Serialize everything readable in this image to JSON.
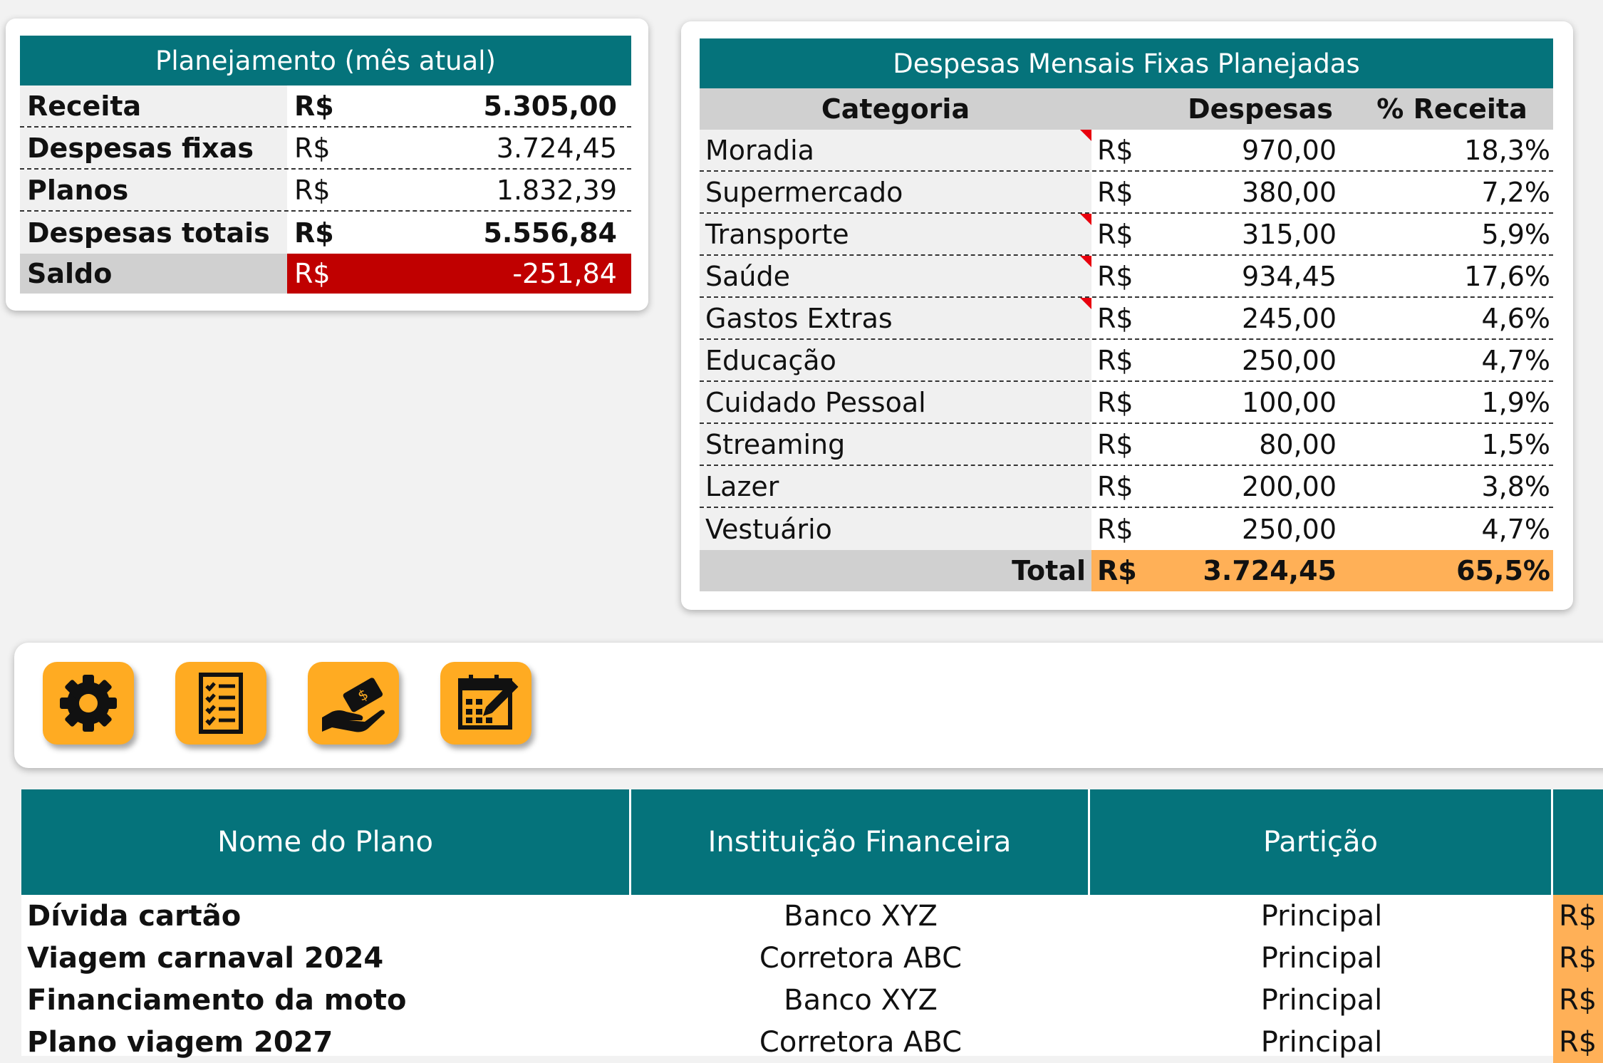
{
  "planning": {
    "title": "Planejamento (mês atual)",
    "rows": [
      {
        "label": "Receita",
        "currency": "R$",
        "value": "5.305,00"
      },
      {
        "label": "Despesas fixas",
        "currency": "R$",
        "value": "3.724,45"
      },
      {
        "label": "Planos",
        "currency": "R$",
        "value": "1.832,39"
      },
      {
        "label": "Despesas totais",
        "currency": "R$",
        "value": "5.556,84"
      },
      {
        "label": "Saldo",
        "currency": "R$",
        "value": "-251,84"
      }
    ]
  },
  "fixed": {
    "title": "Despesas Mensais Fixas Planejadas",
    "headers": {
      "category": "Categoria",
      "expenses": "Despesas",
      "pct": "% Receita"
    },
    "rows": [
      {
        "category": "Moradia",
        "currency": "R$",
        "value": "970,00",
        "pct": "18,3%"
      },
      {
        "category": "Supermercado",
        "currency": "R$",
        "value": "380,00",
        "pct": "7,2%"
      },
      {
        "category": "Transporte",
        "currency": "R$",
        "value": "315,00",
        "pct": "5,9%"
      },
      {
        "category": "Saúde",
        "currency": "R$",
        "value": "934,45",
        "pct": "17,6%"
      },
      {
        "category": "Gastos Extras",
        "currency": "R$",
        "value": "245,00",
        "pct": "4,6%"
      },
      {
        "category": "Educação",
        "currency": "R$",
        "value": "250,00",
        "pct": "4,7%"
      },
      {
        "category": "Cuidado Pessoal",
        "currency": "R$",
        "value": "100,00",
        "pct": "1,9%"
      },
      {
        "category": "Streaming",
        "currency": "R$",
        "value": "80,00",
        "pct": "1,5%"
      },
      {
        "category": "Lazer",
        "currency": "R$",
        "value": "200,00",
        "pct": "3,8%"
      },
      {
        "category": "Vestuário",
        "currency": "R$",
        "value": "250,00",
        "pct": "4,7%"
      }
    ],
    "total": {
      "label": "Total",
      "currency": "R$",
      "value": "3.724,45",
      "pct": "65,5%"
    }
  },
  "toolbar": {
    "icons": [
      "gear-icon",
      "checklist-icon",
      "payment-hand-icon",
      "calendar-edit-icon"
    ],
    "accent": "#ffab22"
  },
  "plans": {
    "headers": {
      "name": "Nome do Plano",
      "institution": "Instituição Financeira",
      "partition": "Partição"
    },
    "rows": [
      {
        "name": "Dívida cartão",
        "institution": "Banco XYZ",
        "partition": "Principal",
        "currency": "R$"
      },
      {
        "name": "Viagem carnaval 2024",
        "institution": "Corretora ABC",
        "partition": "Principal",
        "currency": "R$"
      },
      {
        "name": "Financiamento da moto",
        "institution": "Banco XYZ",
        "partition": "Principal",
        "currency": "R$"
      },
      {
        "name": "Plano viagem 2027",
        "institution": "Corretora ABC",
        "partition": "Principal",
        "currency": "R$"
      }
    ]
  },
  "colors": {
    "teal": "#05737b",
    "negative": "#c00000",
    "total_highlight": "#ffb057",
    "comment_marker": "#e8000e"
  }
}
